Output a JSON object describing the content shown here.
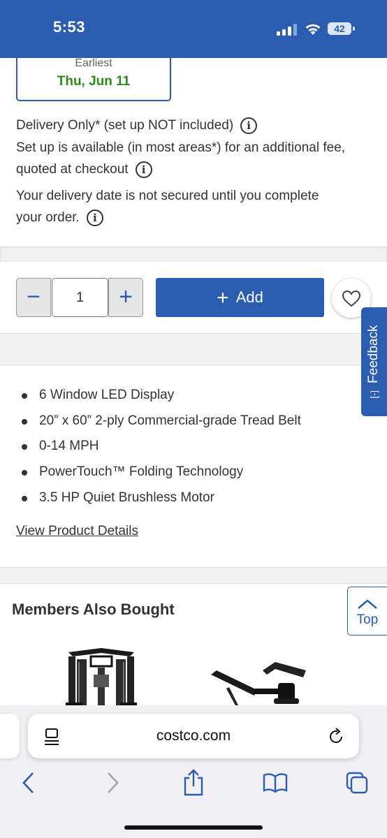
{
  "status_bar": {
    "time": "5:53",
    "battery": "42"
  },
  "delivery": {
    "date_label": "Earliest",
    "date_value": "Thu, Jun 11",
    "line1": "Delivery Only* (set up NOT included)",
    "line2": "Set up is available (in most areas*) for an additional fee,",
    "line3": "quoted at checkout",
    "line4": "Your delivery date is not secured until you complete",
    "line5": "your order.",
    "info_icon": "i"
  },
  "purchase": {
    "quantity": "1",
    "minus_symbol": "−",
    "plus_symbol": "+",
    "add_label": "Add"
  },
  "feedback": {
    "label": "Feedback",
    "icon": "[-]"
  },
  "features": [
    "6 Window LED Display",
    "20” x 60” 2-ply Commercial-grade Tread Belt",
    "0-14 MPH",
    "PowerTouch™ Folding Technology",
    "3.5 HP Quiet Brushless Motor"
  ],
  "details_link": "View Product Details",
  "also_bought": {
    "title": "Members Also Bought"
  },
  "top_button": {
    "label": "Top"
  },
  "browser": {
    "url": "costco.com"
  },
  "colors": {
    "brand_blue": "#2a5db0",
    "date_green": "#2f8a1c"
  }
}
